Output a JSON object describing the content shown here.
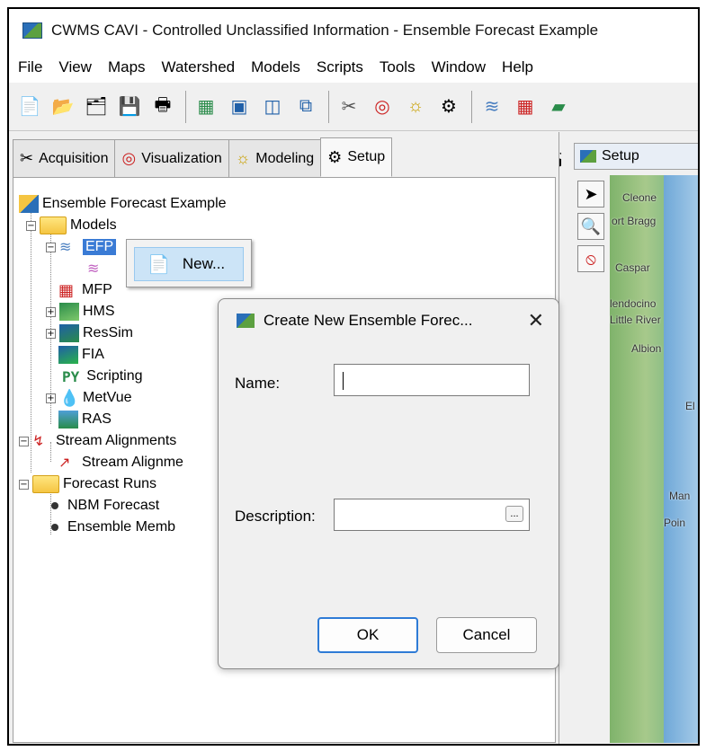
{
  "window": {
    "title": "CWMS CAVI - Controlled Unclassified Information - Ensemble Forecast Example"
  },
  "menubar": [
    "File",
    "View",
    "Maps",
    "Watershed",
    "Models",
    "Scripts",
    "Tools",
    "Window",
    "Help"
  ],
  "toolbar": {
    "icons": [
      "new-watershed-icon",
      "open-watershed-icon",
      "import-icon",
      "save-icon",
      "print-icon",
      "tree-add-icon",
      "tree-edit-icon",
      "panel-layout-icon",
      "window-cascade-icon",
      "acquisition-icon",
      "visualization-icon",
      "modeling-icon",
      "setup-icon",
      "ensemble-icon",
      "grid-icon",
      "map-icon"
    ]
  },
  "tabs": [
    {
      "label": "Acquisition",
      "icon": "acquisition-icon"
    },
    {
      "label": "Visualization",
      "icon": "visualization-icon"
    },
    {
      "label": "Modeling",
      "icon": "modeling-icon"
    },
    {
      "label": "Setup",
      "icon": "gear-icon",
      "active": true
    }
  ],
  "tree": {
    "root": "Ensemble Forecast Example",
    "models": "Models",
    "model_items": {
      "efp": "EFP",
      "mfp": "MFP",
      "hms": "HMS",
      "ressim": "ResSim",
      "fia": "FIA",
      "scripting": "Scripting",
      "metvue": "MetVue",
      "ras": "RAS"
    },
    "scripting_icon_text": "PY",
    "stream_alignments": "Stream Alignments",
    "stream_alignment_child": "Stream Alignme",
    "forecast_runs": "Forecast Runs",
    "nbm": "NBM Forecast",
    "ensemble_member": "Ensemble Memb"
  },
  "context_menu": {
    "new_label": "New..."
  },
  "map_panel": {
    "tab_label": "Setup",
    "place_labels": [
      "Cleone",
      "ort Bragg",
      "Caspar",
      "lendocino",
      "Little River",
      "Albion",
      "El",
      "Man",
      "Poin"
    ]
  },
  "dialog": {
    "title": "Create New Ensemble Forec...",
    "name_label": "Name:",
    "name_value": "",
    "description_label": "Description:",
    "description_value": "",
    "ellipsis": "...",
    "ok": "OK",
    "cancel": "Cancel"
  },
  "colors": {
    "selection": "#cce4f7",
    "selected_node": "#3a7bd5",
    "default_button_border": "#2e7bd6"
  }
}
